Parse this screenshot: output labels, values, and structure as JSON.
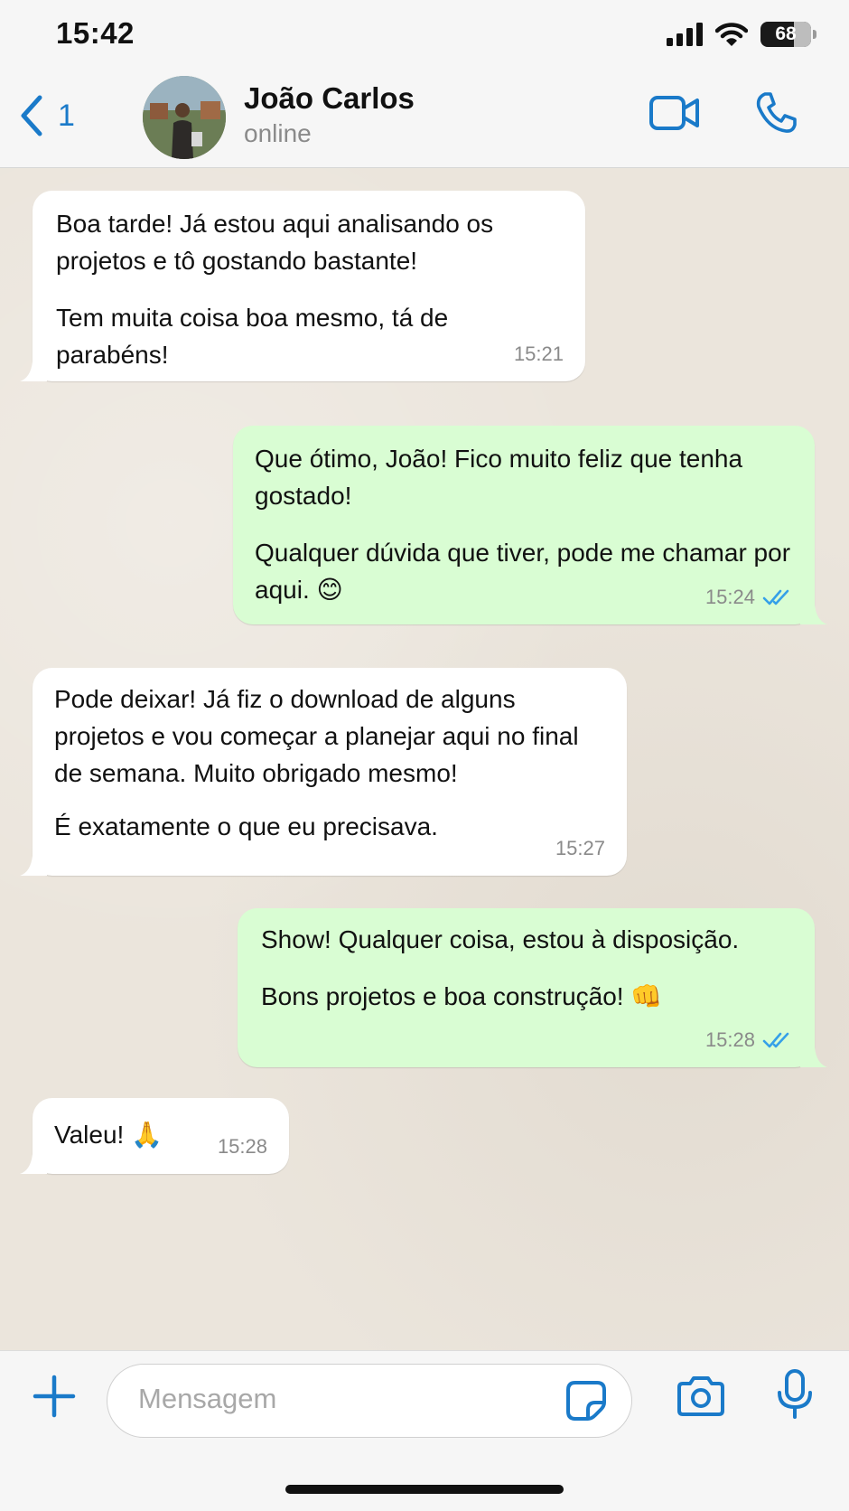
{
  "status_bar": {
    "time": "15:42",
    "battery": "68"
  },
  "header": {
    "back_count": "1",
    "contact_name": "João Carlos",
    "contact_status": "online"
  },
  "messages": [
    {
      "direction": "in",
      "paragraphs": [
        "Boa tarde! Já estou aqui analisando os projetos e tô gostando bastante!",
        "Tem muita coisa boa mesmo, tá de parabéns!"
      ],
      "time": "15:21"
    },
    {
      "direction": "out",
      "paragraphs": [
        "Que ótimo, João! Fico muito feliz que tenha gostado!",
        "Qualquer dúvida que tiver, pode me chamar por aqui. 😊"
      ],
      "time": "15:24",
      "read": true
    },
    {
      "direction": "in",
      "paragraphs": [
        "Pode deixar! Já fiz o download de alguns projetos e vou começar a planejar aqui no final de semana. Muito obrigado mesmo!",
        "É exatamente o que eu precisava."
      ],
      "time": "15:27"
    },
    {
      "direction": "out",
      "paragraphs": [
        "Show! Qualquer coisa, estou à disposição.",
        "Bons projetos e boa construção! 👊"
      ],
      "time": "15:28",
      "read": true
    },
    {
      "direction": "in",
      "paragraphs": [
        "Valeu! 🙏"
      ],
      "time": "15:28"
    }
  ],
  "input": {
    "placeholder": "Mensagem"
  },
  "colors": {
    "accent": "#1a7ac9",
    "outgoing_bubble": "#d9fdd3",
    "incoming_bubble": "#ffffff",
    "read_ticks": "#35a0e8"
  },
  "icons": [
    "back-chevron-icon",
    "video-camera-icon",
    "phone-icon",
    "plus-icon",
    "sticker-icon",
    "camera-icon",
    "microphone-icon",
    "double-check-icon"
  ]
}
